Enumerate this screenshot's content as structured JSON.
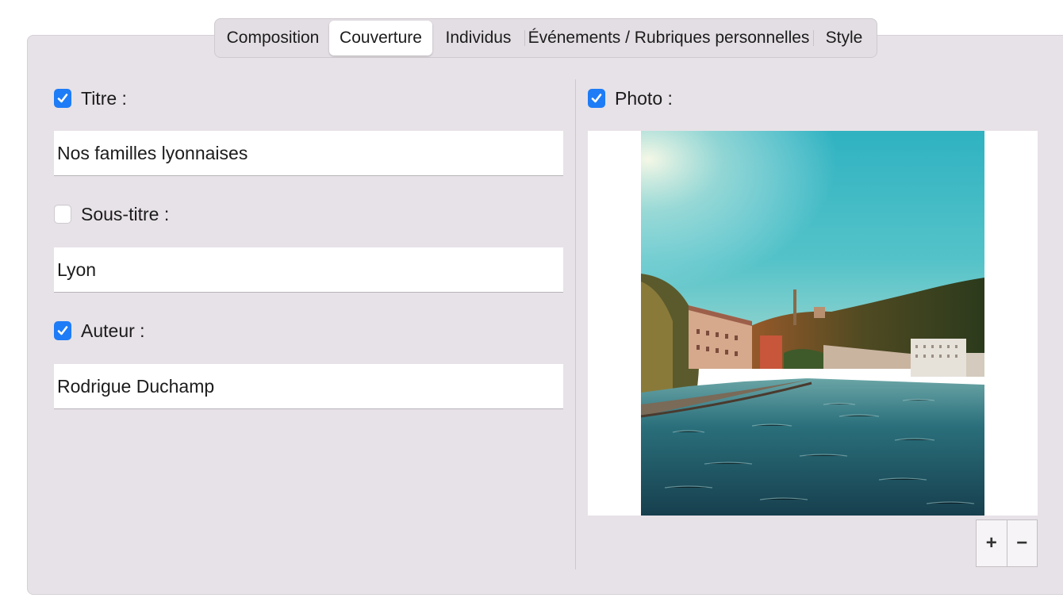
{
  "tabs": [
    {
      "label": "Composition",
      "selected": false
    },
    {
      "label": "Couverture",
      "selected": true
    },
    {
      "label": "Individus",
      "selected": false
    },
    {
      "label": "Événements / Rubriques personnelles",
      "selected": false
    },
    {
      "label": "Style",
      "selected": false
    }
  ],
  "left": {
    "title": {
      "label": "Titre :",
      "checked": true,
      "value": "Nos familles lyonnaises"
    },
    "subtitle": {
      "label": "Sous-titre :",
      "checked": false,
      "value": "Lyon"
    },
    "author": {
      "label": "Auteur :",
      "checked": true,
      "value": "Rodrigue Duchamp"
    }
  },
  "right": {
    "photo": {
      "label": "Photo :",
      "checked": true
    },
    "add_label": "+",
    "remove_label": "−"
  },
  "icons": {
    "checkmark": "checkmark-icon",
    "add": "plus-icon",
    "remove": "minus-icon"
  },
  "colors": {
    "accent": "#1e7cf7",
    "panel": "#e7e2e7",
    "sky": "#3fb6c2",
    "water": "#1f5a6a"
  }
}
